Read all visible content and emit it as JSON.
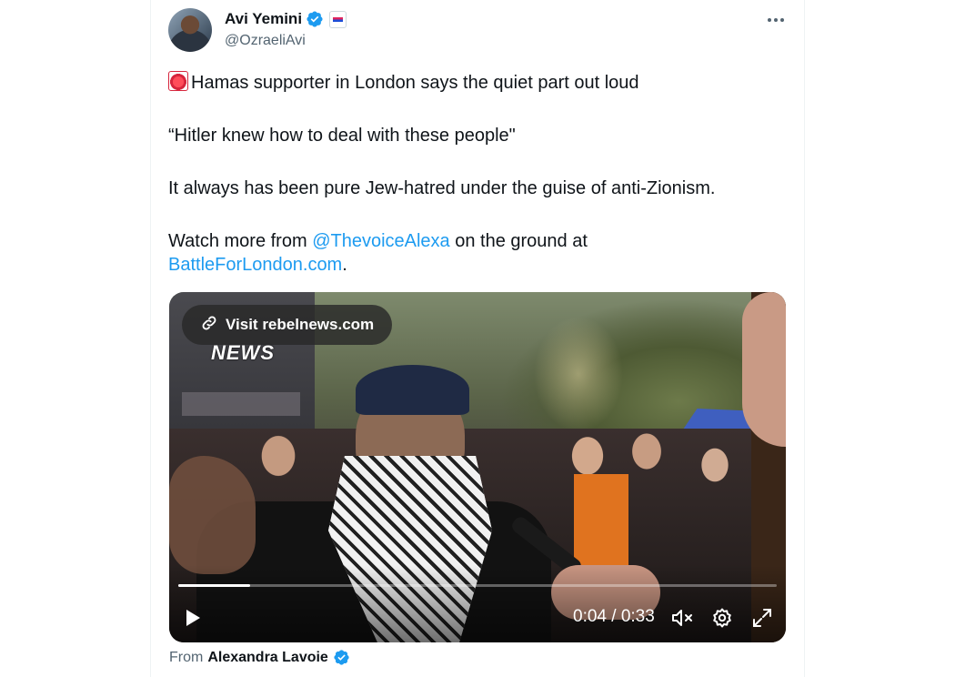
{
  "author": {
    "display_name": "Avi Yemini",
    "handle": "@OzraeliAvi",
    "verified_icon": "verified-badge-icon",
    "affiliation_icon": "affiliate-badge-icon"
  },
  "menu": {
    "icon": "more-options-icon"
  },
  "tweet": {
    "line1_emoji": "rotating-light-emoji",
    "line1": "Hamas supporter in London says the quiet part out loud",
    "line2": "“Hitler knew how to deal with these people\"",
    "line3": "It always has been pure Jew-hatred under the guise of anti-Zionism.",
    "line4_prefix": "Watch more from ",
    "line4_mention": "@ThevoiceAlexa",
    "line4_middle": " on the ground at",
    "line4_link": "BattleForLondon.com",
    "line4_suffix": "."
  },
  "video": {
    "visit_label": "Visit rebelnews.com",
    "watermark": "NEWS",
    "current_time": "0:04",
    "time_separator": " / ",
    "duration": "0:33",
    "progress": 0.12,
    "icons": [
      "link-icon",
      "play-icon",
      "mute-icon",
      "settings-icon",
      "fullscreen-icon"
    ]
  },
  "attribution": {
    "from_label": "From",
    "name": "Alexandra Lavoie",
    "verified_icon": "verified-badge-icon"
  },
  "colors": {
    "link": "#1d9bf0",
    "text": "#0f1419",
    "secondary": "#536471",
    "verified": "#1d9bf0"
  }
}
